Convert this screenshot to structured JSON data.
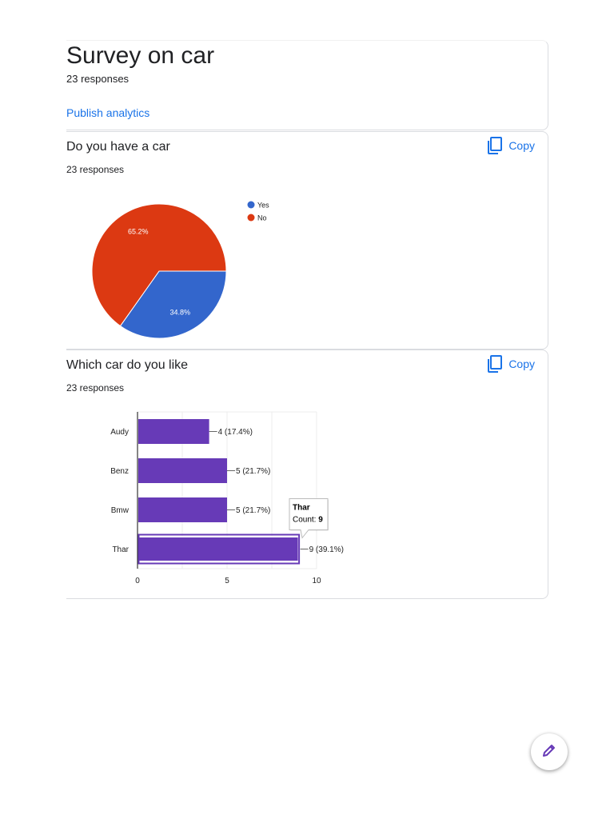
{
  "header": {
    "title": "Survey on car",
    "responses": "23 responses",
    "publish_label": "Publish analytics"
  },
  "questions": [
    {
      "title": "Do you have a car",
      "responses": "23 responses",
      "copy_label": "Copy",
      "copy_icon": "copy-icon"
    },
    {
      "title": "Which car do you like",
      "responses": "23 responses",
      "copy_label": "Copy",
      "copy_icon": "copy-icon"
    }
  ],
  "fab": {
    "icon": "pencil-icon",
    "color": "#673ab7"
  },
  "colors": {
    "accent": "#1a73e8",
    "yes": "#3366cc",
    "no": "#dc3912",
    "bar": "#673ab7"
  },
  "chart_data": [
    {
      "type": "pie",
      "labels": [
        "Yes",
        "No"
      ],
      "values": [
        34.8,
        65.2
      ],
      "slice_labels": [
        "34.8%",
        "65.2%"
      ],
      "colors": [
        "#3366cc",
        "#dc3912"
      ],
      "legend_position": "right"
    },
    {
      "type": "bar",
      "orientation": "horizontal",
      "categories": [
        "Audy",
        "Benz",
        "Bmw",
        "Thar"
      ],
      "values": [
        4,
        5,
        5,
        9
      ],
      "data_labels": [
        "4 (17.4%)",
        "5 (21.7%)",
        "5 (21.7%)",
        "9 (39.1%)"
      ],
      "xlim": [
        0,
        10
      ],
      "xticks": [
        0,
        5,
        10
      ],
      "grid": true,
      "color": "#673ab7",
      "highlighted": "Thar",
      "tooltip": {
        "title": "Thar",
        "label": "Count: ",
        "value": "9"
      }
    }
  ]
}
